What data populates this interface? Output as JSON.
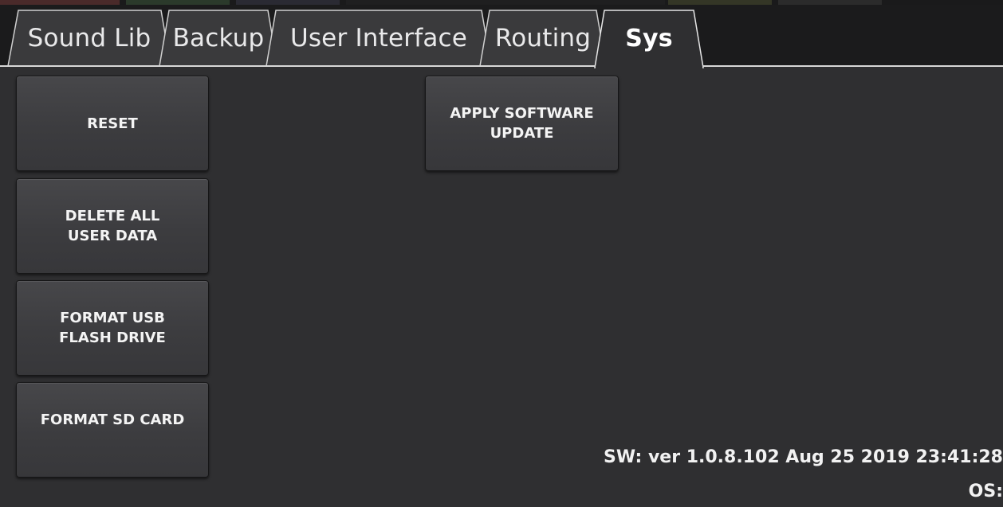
{
  "tabs": [
    {
      "label": "Sound Lib",
      "active": false
    },
    {
      "label": "Backup",
      "active": false
    },
    {
      "label": "User Interface",
      "active": false
    },
    {
      "label": "Routing",
      "active": false
    },
    {
      "label": "Sys",
      "active": true
    }
  ],
  "buttons": {
    "reset": "RESET",
    "delete_all_user_data": "DELETE ALL\nUSER DATA",
    "format_usb": "FORMAT USB\nFLASH DRIVE",
    "format_sd": "FORMAT SD CARD",
    "apply_update": "APPLY SOFTWARE\nUPDATE"
  },
  "info": {
    "sw_version": "SW: ver 1.0.8.102 Aug 25 2019 23:41:28",
    "os_label": "OS:"
  },
  "colors": {
    "background": "#2f2f31",
    "tab_bar": "#1b1b1c",
    "button": "#424245",
    "text": "#f4f4f4"
  }
}
